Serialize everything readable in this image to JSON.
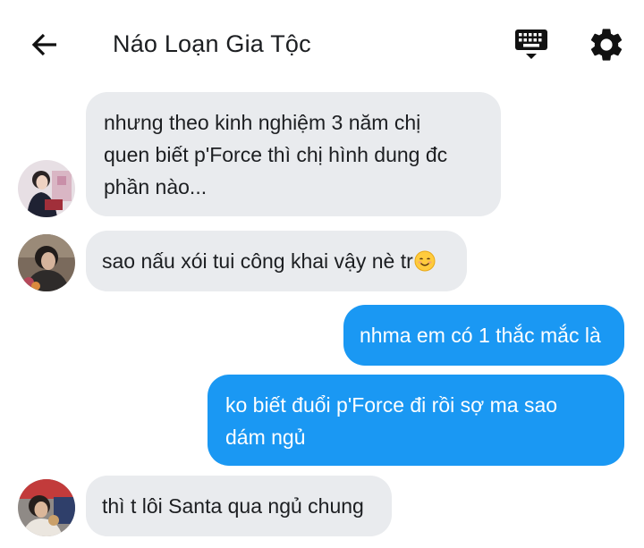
{
  "header": {
    "title": "Náo Loạn Gia Tộc",
    "back_icon": "arrow-left-icon",
    "keyboard_icon": "keyboard-icon",
    "settings_icon": "gear-icon"
  },
  "messages": [
    {
      "sender": "other",
      "lines": [
        "nhưng theo kinh nghiệm 3 năm chị",
        "quen biết p'Force thì chị hình dung đc",
        "phần nào..."
      ]
    },
    {
      "sender": "other",
      "text": "sao nấu xói tui công khai vậy nè tr",
      "emoji": "smiling-face-emoji"
    },
    {
      "sender": "me",
      "text": "nhma em có 1 thắc mắc là"
    },
    {
      "sender": "me",
      "lines": [
        "ko biết đuổi p'Force đi rồi sợ ma sao",
        "dám ngủ"
      ]
    },
    {
      "sender": "other",
      "text": "thì t lôi Santa qua ngủ chung"
    }
  ],
  "colors": {
    "incoming_bubble": "#e9ebee",
    "outgoing_bubble": "#1a98f3",
    "outgoing_text": "#ffffff",
    "text": "#1c1e21"
  }
}
